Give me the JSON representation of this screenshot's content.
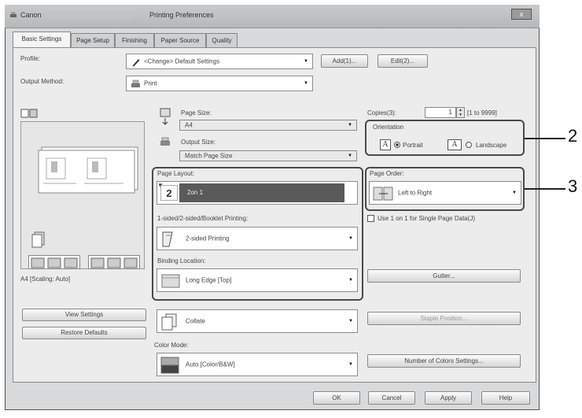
{
  "window": {
    "app_name": "Canon",
    "title": "Printing Preferences",
    "close_label": "x"
  },
  "tabs": [
    {
      "label": "Basic Settings",
      "active": true
    },
    {
      "label": "Page Setup",
      "active": false
    },
    {
      "label": "Finishing",
      "active": false
    },
    {
      "label": "Paper Source",
      "active": false
    },
    {
      "label": "Quality",
      "active": false
    }
  ],
  "profile": {
    "label": "Profile:",
    "value": "<Change> Default Settings",
    "add_label": "Add(1)...",
    "edit_label": "Edit(2)..."
  },
  "output_method": {
    "label": "Output Method:",
    "value": "Print"
  },
  "preview": {
    "status": "A4 [Scaling: Auto]",
    "view_settings_label": "View Settings",
    "restore_defaults_label": "Restore Defaults"
  },
  "page_size": {
    "label": "Page Size:",
    "value": "A4"
  },
  "output_size": {
    "label": "Output Size:",
    "value": "Match Page Size"
  },
  "copies": {
    "label": "Copies(3):",
    "value": "1",
    "range": "[1 to 9999]"
  },
  "orientation": {
    "label": "Orientation",
    "portrait_label": "Portrait",
    "landscape_label": "Landscape",
    "selected": "Portrait",
    "glyph": "A"
  },
  "page_layout": {
    "label": "Page Layout:",
    "value": "2on 1",
    "badge": "2"
  },
  "page_order": {
    "label": "Page Order:",
    "value": "Left to Right"
  },
  "single_page_data": {
    "label": "Use 1 on 1 for Single Page Data(J)",
    "checked": false
  },
  "printing_mode": {
    "label": "1-sided/2-sided/Booklet Printing:",
    "value": "2-sided Printing"
  },
  "binding": {
    "label": "Binding Location:",
    "value": "Long Edge [Top]",
    "gutter_label": "Gutter..."
  },
  "collate": {
    "value": "Collate",
    "staple_position_label": "Staple Position..."
  },
  "color_mode": {
    "label": "Color Mode:",
    "value": "Auto [Color/B&W]",
    "number_of_colors_label": "Number of Colors Settings..."
  },
  "footer": {
    "ok_label": "OK",
    "cancel_label": "Cancel",
    "apply_label": "Apply",
    "help_label": "Help"
  },
  "callouts": {
    "orientation_number": "2",
    "layout_number": "3"
  },
  "colors": {
    "highlight_border": "#4a4a4a",
    "selected_dropdown": "#5a5a5a",
    "window_background": "#d9dadc"
  }
}
